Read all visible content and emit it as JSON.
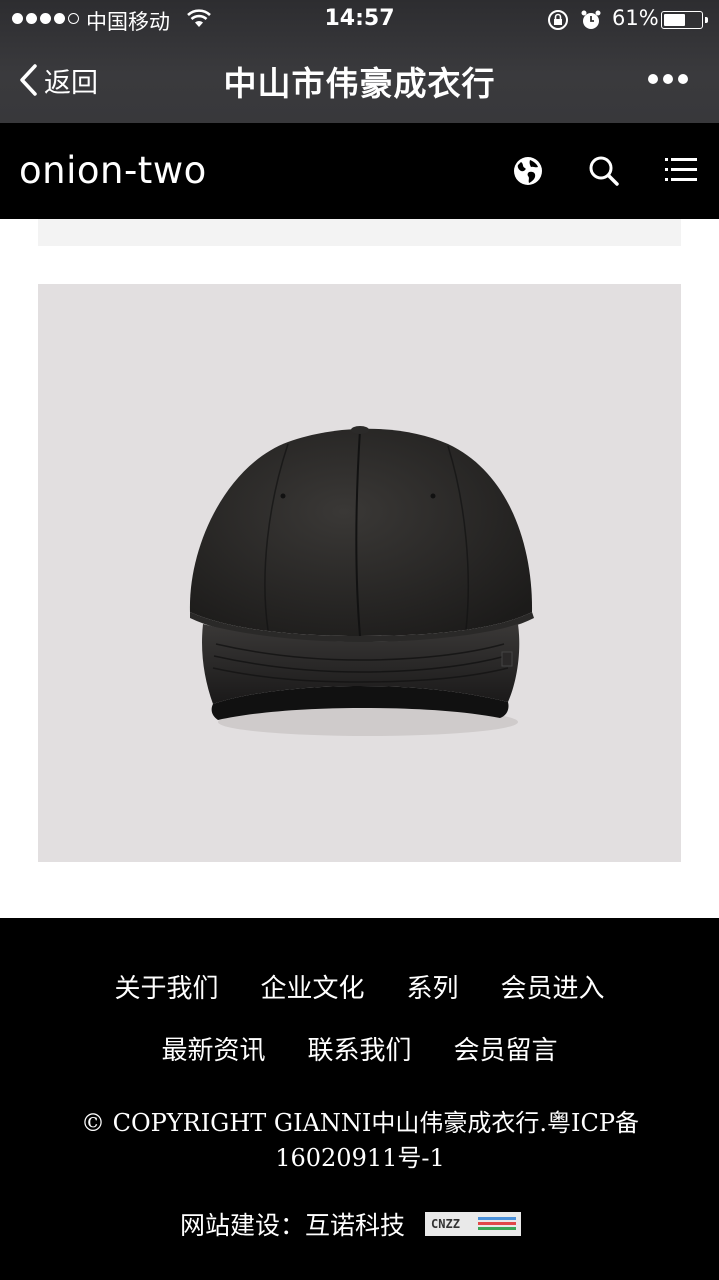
{
  "status_bar": {
    "carrier": "中国移动",
    "time": "14:57",
    "battery_percent": "61%",
    "battery_level": 0.61
  },
  "nav_bar": {
    "back_label": "返回",
    "title": "中山市伟豪成衣行"
  },
  "site_header": {
    "logo": "onion-two"
  },
  "footer": {
    "links_row1": [
      "关于我们",
      "企业文化",
      "系列",
      "会员进入"
    ],
    "links_row2": [
      "最新资讯",
      "联系我们",
      "会员留言"
    ],
    "copyright": "© COPYRIGHT GIANNI中山伟豪成衣行.粤ICP备16020911号-1",
    "builder": "网站建设：互诺科技",
    "badge_text": "CNZZ"
  },
  "colors": {
    "header_bg": "#000000",
    "product_bg": "#e2dfe0",
    "nav_bg": "#38383b"
  }
}
